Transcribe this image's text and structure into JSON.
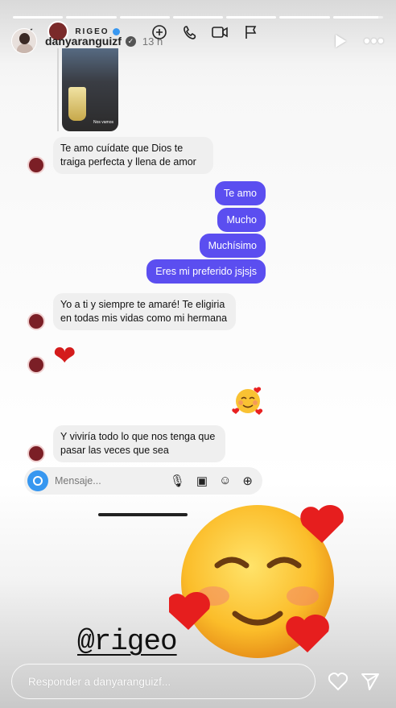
{
  "story": {
    "username": "danyaranguizf",
    "time": "13 h",
    "progress": [
      1,
      1,
      1,
      1,
      1,
      1,
      0.9
    ],
    "reply_placeholder": "Responder a danyaranguizf..."
  },
  "dm": {
    "contact_name": "RIGEO",
    "photo_caption": "Nos vamos",
    "messages": [
      {
        "side": "in",
        "text": "Te amo cuídate que Dios te traiga perfecta y llena de amor"
      },
      {
        "side": "out",
        "text": "Te amo"
      },
      {
        "side": "out",
        "text": "Mucho"
      },
      {
        "side": "out",
        "text": "Muchísimo"
      },
      {
        "side": "out",
        "text": "Eres mi preferido jsjsjs"
      },
      {
        "side": "in",
        "text": "Yo a ti y siempre te amaré! Te eligiria en todas mis vidas como mi hermana"
      },
      {
        "side": "in",
        "text": "❤"
      },
      {
        "side": "out",
        "text": "☺"
      },
      {
        "side": "in",
        "text": "Y viviría todo lo que nos tenga que pasar las veces que sea"
      }
    ],
    "composer_placeholder": "Mensaje..."
  },
  "mention": "@rigeo",
  "colors": {
    "outgoing": "#5b4ef0",
    "incoming": "#efefef",
    "heart": "#d41c1c"
  }
}
